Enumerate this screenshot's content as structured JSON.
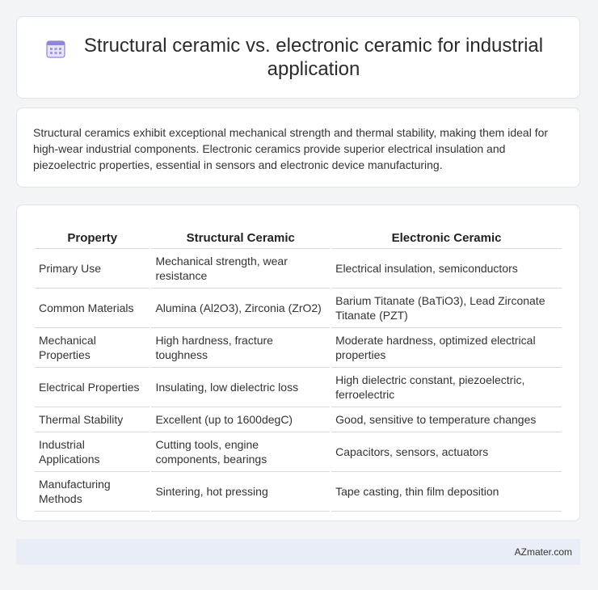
{
  "header": {
    "title": "Structural ceramic vs. electronic ceramic for industrial application",
    "icon": "calendar-icon",
    "accent": "#7b6fd6"
  },
  "summary": {
    "text": "Structural ceramics exhibit exceptional mechanical strength and thermal stability, making them ideal for high-wear industrial components. Electronic ceramics provide superior electrical insulation and piezoelectric properties, essential in sensors and electronic device manufacturing."
  },
  "table": {
    "headers": [
      "Property",
      "Structural Ceramic",
      "Electronic Ceramic"
    ],
    "rows": [
      [
        "Primary Use",
        "Mechanical strength, wear resistance",
        "Electrical insulation, semiconductors"
      ],
      [
        "Common Materials",
        "Alumina (Al2O3), Zirconia (ZrO2)",
        "Barium Titanate (BaTiO3), Lead Zirconate Titanate (PZT)"
      ],
      [
        "Mechanical Properties",
        "High hardness, fracture toughness",
        "Moderate hardness, optimized electrical properties"
      ],
      [
        "Electrical Properties",
        "Insulating, low dielectric loss",
        "High dielectric constant, piezoelectric, ferroelectric"
      ],
      [
        "Thermal Stability",
        "Excellent (up to 1600degC)",
        "Good, sensitive to temperature changes"
      ],
      [
        "Industrial Applications",
        "Cutting tools, engine components, bearings",
        "Capacitors, sensors, actuators"
      ],
      [
        "Manufacturing Methods",
        "Sintering, hot pressing",
        "Tape casting, thin film deposition"
      ]
    ]
  },
  "footer": {
    "text": "AZmater.com"
  }
}
